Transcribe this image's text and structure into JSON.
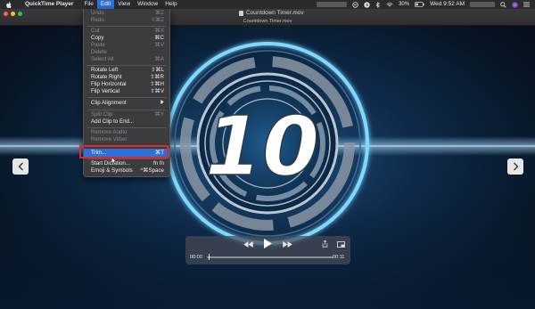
{
  "menubar": {
    "app_name": "QuickTime Player",
    "menus": [
      "File",
      "Edit",
      "View",
      "Window",
      "Help"
    ],
    "battery": "30%",
    "clock": "Wed 9:52 AM"
  },
  "window": {
    "title": "Countdown Timer.mov",
    "tab_title": "Countdown Timer.mov"
  },
  "video": {
    "number": "10"
  },
  "edit_menu": {
    "items": [
      {
        "label": "Undo",
        "shortcut": "⌘Z",
        "disabled": true
      },
      {
        "label": "Redo",
        "shortcut": "⇧⌘Z",
        "disabled": true
      },
      {
        "label": "Cut",
        "shortcut": "⌘X",
        "disabled": true
      },
      {
        "label": "Copy",
        "shortcut": "⌘C",
        "disabled": false
      },
      {
        "label": "Paste",
        "shortcut": "⌘V",
        "disabled": true
      },
      {
        "label": "Delete",
        "shortcut": "",
        "disabled": true
      },
      {
        "label": "Select All",
        "shortcut": "⌘A",
        "disabled": true
      },
      {
        "label": "Rotate Left",
        "shortcut": "⇧⌘L",
        "disabled": false
      },
      {
        "label": "Rotate Right",
        "shortcut": "⇧⌘R",
        "disabled": false
      },
      {
        "label": "Flip Horizontal",
        "shortcut": "⇧⌘H",
        "disabled": false
      },
      {
        "label": "Flip Vertical",
        "shortcut": "⇧⌘V",
        "disabled": false
      },
      {
        "label": "Clip Alignment",
        "shortcut": "",
        "disabled": false
      },
      {
        "label": "Split Clip",
        "shortcut": "⌘Y",
        "disabled": true
      },
      {
        "label": "Add Clip to End...",
        "shortcut": "",
        "disabled": false
      },
      {
        "label": "Remove Audio",
        "shortcut": "",
        "disabled": true
      },
      {
        "label": "Remove Video",
        "shortcut": "",
        "disabled": true
      },
      {
        "label": "Trim...",
        "shortcut": "⌘T",
        "disabled": false
      },
      {
        "label": "Start Dictation...",
        "shortcut": "fn fn",
        "disabled": false
      },
      {
        "label": "Emoji & Symbols",
        "shortcut": "^⌘Space",
        "disabled": false
      }
    ]
  },
  "controls": {
    "time_elapsed": "00:00",
    "time_remaining": "00:11"
  },
  "colors": {
    "menu_highlight": "#2f6fd6",
    "annotation_red": "#d92b2b",
    "glow": "#7fd8ff"
  }
}
